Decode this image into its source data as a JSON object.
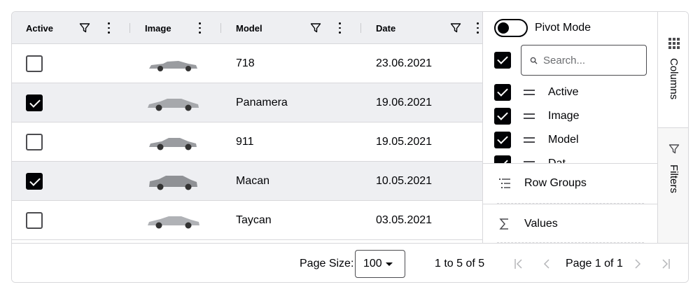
{
  "columns": [
    {
      "label": "Active",
      "has_filter": true
    },
    {
      "label": "Image",
      "has_filter": false
    },
    {
      "label": "Model",
      "has_filter": true
    },
    {
      "label": "Date",
      "has_filter": true
    }
  ],
  "rows": [
    {
      "active": false,
      "model": "718",
      "date": "23.06.2021"
    },
    {
      "active": true,
      "model": "Panamera",
      "date": "19.06.2021"
    },
    {
      "active": false,
      "model": "911",
      "date": "19.05.2021"
    },
    {
      "active": true,
      "model": "Macan",
      "date": "10.05.2021"
    },
    {
      "active": false,
      "model": "Taycan",
      "date": "03.05.2021"
    }
  ],
  "panel": {
    "pivot_label": "Pivot Mode",
    "pivot_on": false,
    "search_placeholder": "Search...",
    "column_list": [
      "Active",
      "Image",
      "Model",
      "Dat"
    ],
    "row_groups_label": "Row Groups",
    "values_label": "Values"
  },
  "side_tabs": {
    "columns": "Columns",
    "filters": "Filters"
  },
  "footer": {
    "page_size_label": "Page Size:",
    "page_size_value": "100",
    "range_text": "1 to 5 of 5",
    "page_text": "Page 1 of 1"
  },
  "colors": {
    "header_bg": "#eeeff2",
    "alt_row_bg": "#eeeff2",
    "border": "#d8d8db",
    "text": "#010205",
    "disabled": "#b5b6b9"
  }
}
